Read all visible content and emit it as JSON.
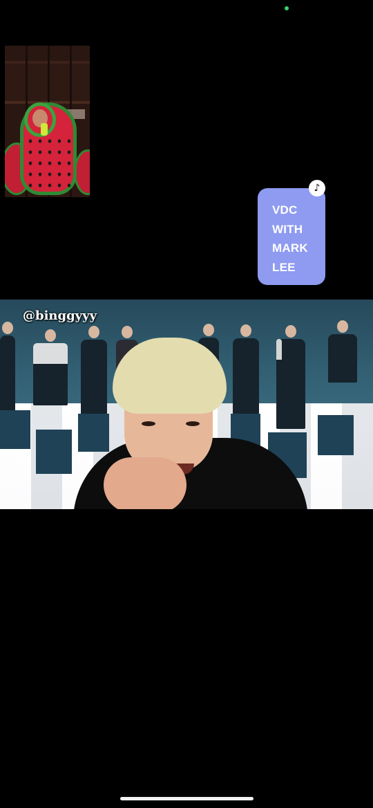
{
  "status_bar": {
    "indicator_color": "#3ad06a"
  },
  "self_view": {
    "description_icon": "camera-self-view"
  },
  "caption_sticker": {
    "lines": [
      "VDC",
      "WITH",
      "MARK",
      "LEE"
    ],
    "background": "#8e9bf0",
    "badge_icon": "tiktok-icon",
    "badge_glyph": "♪"
  },
  "main_video": {
    "watermark": "@binggyyy"
  },
  "home_indicator": {
    "color": "#f2f2f2"
  }
}
